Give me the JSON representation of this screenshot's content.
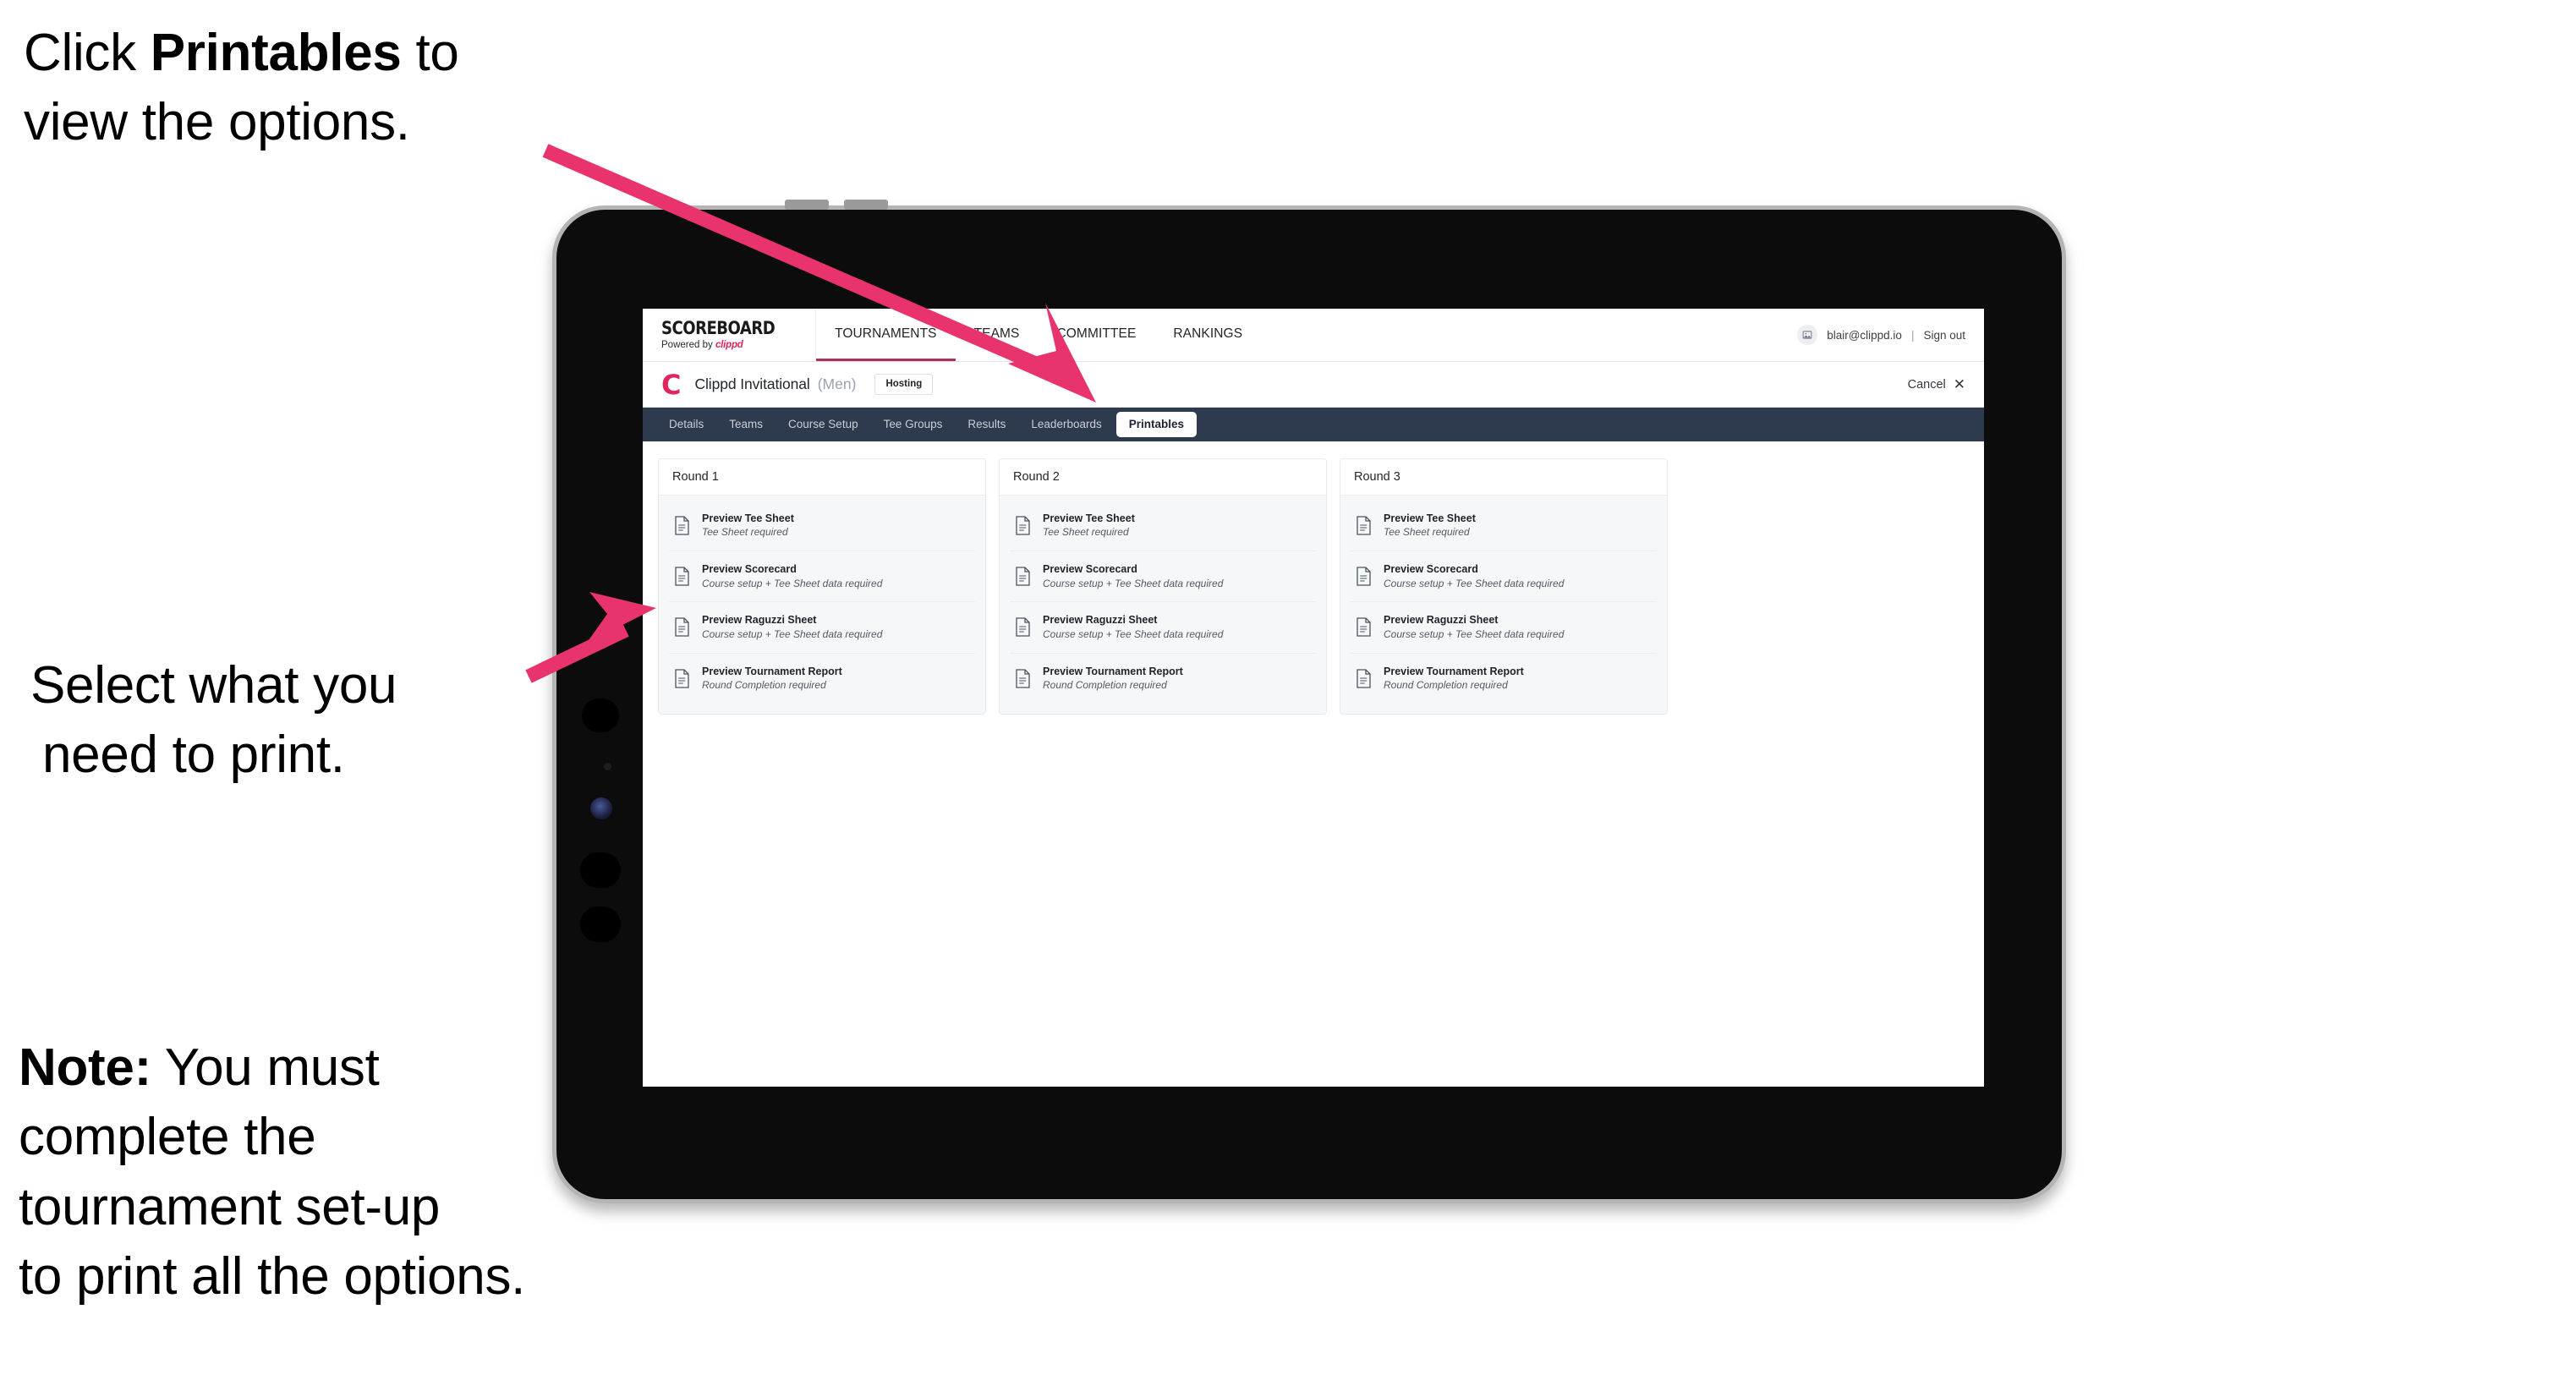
{
  "annotations": {
    "top": {
      "line1_pre": "Click ",
      "line1_bold": "Printables",
      "line1_post": " to",
      "line2": "view the options."
    },
    "middle": {
      "line1": "Select what you",
      "line2": "need to print."
    },
    "note": {
      "bold": "Note:",
      "line1_rest": " You must",
      "line2": "complete the",
      "line3": "tournament set-up",
      "line4": "to print all the options."
    }
  },
  "app": {
    "brand": {
      "title": "SCOREBOARD",
      "powered_prefix": "Powered by ",
      "powered_name": "clippd"
    },
    "top_nav": [
      {
        "label": "TOURNAMENTS",
        "active": true
      },
      {
        "label": "TEAMS",
        "active": false
      },
      {
        "label": "COMMITTEE",
        "active": false
      },
      {
        "label": "RANKINGS",
        "active": false
      }
    ],
    "account": {
      "avatar_icon": "user-avatar-icon",
      "email": "blair@clippd.io",
      "separator": "|",
      "sign_out": "Sign out"
    },
    "tournament": {
      "logo_letter": "C",
      "name": "Clippd Invitational",
      "gender": "(Men)",
      "badge": "Hosting",
      "cancel_label": "Cancel",
      "cancel_icon": "close-x-icon"
    },
    "tabs": [
      {
        "label": "Details",
        "active": false
      },
      {
        "label": "Teams",
        "active": false
      },
      {
        "label": "Course Setup",
        "active": false
      },
      {
        "label": "Tee Groups",
        "active": false
      },
      {
        "label": "Results",
        "active": false
      },
      {
        "label": "Leaderboards",
        "active": false
      },
      {
        "label": "Printables",
        "active": true
      }
    ],
    "rounds": [
      {
        "title": "Round 1",
        "items": [
          {
            "title": "Preview Tee Sheet",
            "subtitle": "Tee Sheet required",
            "icon": "document-icon"
          },
          {
            "title": "Preview Scorecard",
            "subtitle": "Course setup + Tee Sheet data required",
            "icon": "document-icon"
          },
          {
            "title": "Preview Raguzzi Sheet",
            "subtitle": "Course setup + Tee Sheet data required",
            "icon": "document-icon"
          },
          {
            "title": "Preview Tournament Report",
            "subtitle": "Round Completion required",
            "icon": "document-icon"
          }
        ]
      },
      {
        "title": "Round 2",
        "items": [
          {
            "title": "Preview Tee Sheet",
            "subtitle": "Tee Sheet required",
            "icon": "document-icon"
          },
          {
            "title": "Preview Scorecard",
            "subtitle": "Course setup + Tee Sheet data required",
            "icon": "document-icon"
          },
          {
            "title": "Preview Raguzzi Sheet",
            "subtitle": "Course setup + Tee Sheet data required",
            "icon": "document-icon"
          },
          {
            "title": "Preview Tournament Report",
            "subtitle": "Round Completion required",
            "icon": "document-icon"
          }
        ]
      },
      {
        "title": "Round 3",
        "items": [
          {
            "title": "Preview Tee Sheet",
            "subtitle": "Tee Sheet required",
            "icon": "document-icon"
          },
          {
            "title": "Preview Scorecard",
            "subtitle": "Course setup + Tee Sheet data required",
            "icon": "document-icon"
          },
          {
            "title": "Preview Raguzzi Sheet",
            "subtitle": "Course setup + Tee Sheet data required",
            "icon": "document-icon"
          },
          {
            "title": "Preview Tournament Report",
            "subtitle": "Round Completion required",
            "icon": "document-icon"
          }
        ]
      }
    ]
  },
  "colors": {
    "accent_pink": "#e8336d",
    "brand_red": "#e0245e",
    "tabbar_dark": "#2e3a4e",
    "panel_gray": "#f6f7f8",
    "active_underline": "#a8325a"
  }
}
